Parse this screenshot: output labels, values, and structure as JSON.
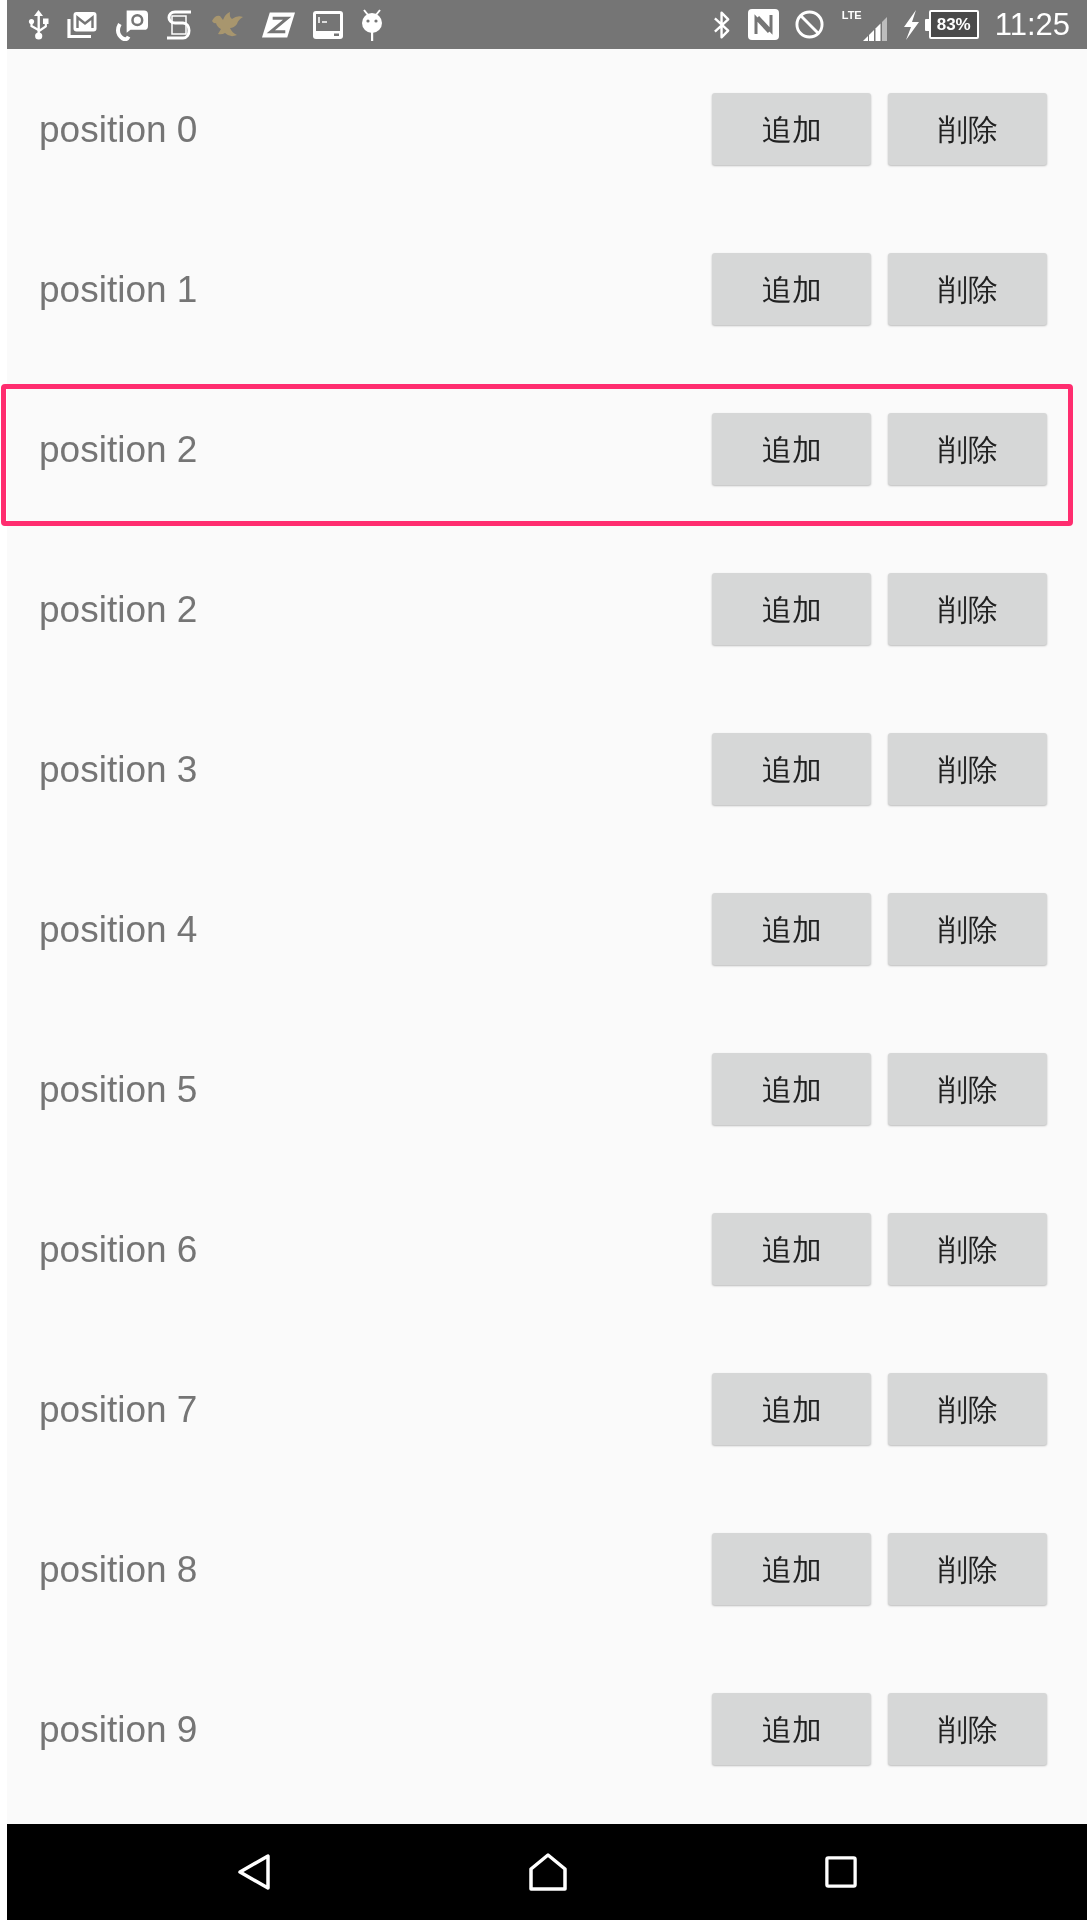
{
  "status_bar": {
    "network": "LTE",
    "battery": "83%",
    "time": "11:25"
  },
  "rows": [
    {
      "label": "position 0",
      "add": "追加",
      "delete": "削除",
      "highlighted": false
    },
    {
      "label": "position 1",
      "add": "追加",
      "delete": "削除",
      "highlighted": false
    },
    {
      "label": "position 2",
      "add": "追加",
      "delete": "削除",
      "highlighted": true
    },
    {
      "label": "position 2",
      "add": "追加",
      "delete": "削除",
      "highlighted": false
    },
    {
      "label": "position 3",
      "add": "追加",
      "delete": "削除",
      "highlighted": false
    },
    {
      "label": "position 4",
      "add": "追加",
      "delete": "削除",
      "highlighted": false
    },
    {
      "label": "position 5",
      "add": "追加",
      "delete": "削除",
      "highlighted": false
    },
    {
      "label": "position 6",
      "add": "追加",
      "delete": "削除",
      "highlighted": false
    },
    {
      "label": "position 7",
      "add": "追加",
      "delete": "削除",
      "highlighted": false
    },
    {
      "label": "position 8",
      "add": "追加",
      "delete": "削除",
      "highlighted": false
    },
    {
      "label": "position 9",
      "add": "追加",
      "delete": "削除",
      "highlighted": false
    }
  ]
}
